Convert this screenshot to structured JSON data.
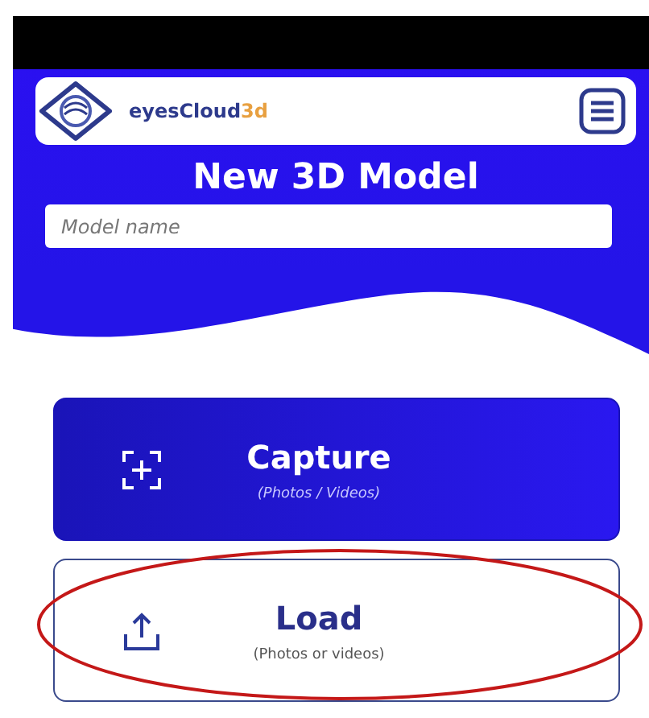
{
  "header": {
    "logo_text": "eyesCloud",
    "logo_suffix": "3d",
    "title": "New 3D Model"
  },
  "model_name": {
    "placeholder": "Model name"
  },
  "actions": [
    {
      "kind": "filled",
      "label": "Capture",
      "sublabel": "(Photos / Videos)",
      "circled": false
    },
    {
      "kind": "outline",
      "label": "Load",
      "sublabel": "(Photos or videos)",
      "circled": true
    }
  ]
}
